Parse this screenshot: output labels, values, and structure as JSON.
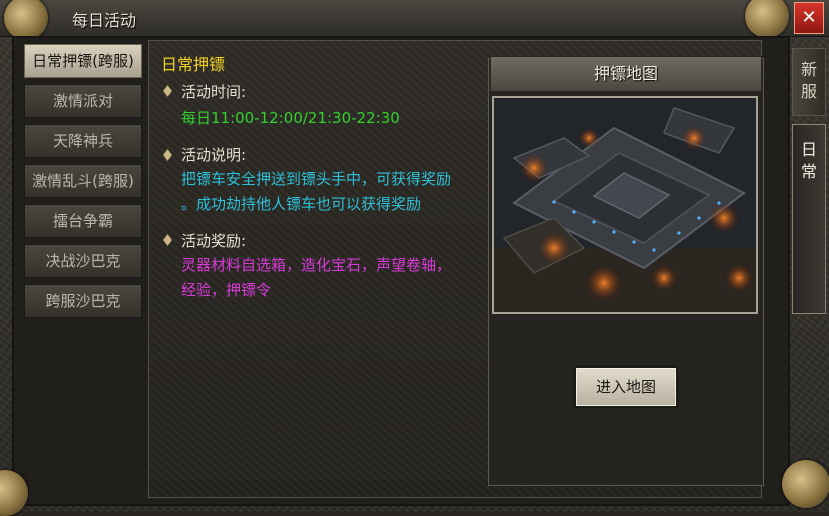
{
  "window": {
    "title": "每日活动",
    "close_label": "✕"
  },
  "nav": {
    "items": [
      {
        "label": "日常押镖(跨服)",
        "active": true
      },
      {
        "label": "激情派对",
        "active": false
      },
      {
        "label": "天降神兵",
        "active": false
      },
      {
        "label": "激情乱斗(跨服)",
        "active": false
      },
      {
        "label": "擂台争霸",
        "active": false
      },
      {
        "label": "决战沙巴克",
        "active": false
      },
      {
        "label": "跨服沙巴克",
        "active": false
      }
    ]
  },
  "side_tabs": [
    {
      "chars": [
        "新",
        "服"
      ],
      "active": false
    },
    {
      "chars": [
        "日",
        "常"
      ],
      "active": true
    }
  ],
  "content": {
    "title": "日常押镖",
    "time_label": "活动时间:",
    "time_value": "每日11:00-12:00/21:30-22:30",
    "desc_label": "活动说明:",
    "desc_lines": [
      "把镖车安全押送到镖头手中，可获得奖励",
      "。成功劫持他人镖车也可以获得奖励"
    ],
    "reward_label": "活动奖励:",
    "reward_lines": [
      "灵器材料自选箱，造化宝石，声望卷轴，",
      "经验，押镖令"
    ]
  },
  "map": {
    "header": "押镖地图",
    "enter_button": "进入地图"
  },
  "colors": {
    "section_title": "#f2d21e",
    "time_value": "#33d12f",
    "description": "#2ec0d6",
    "reward": "#d83ad8",
    "close_button": "#c4281f"
  }
}
